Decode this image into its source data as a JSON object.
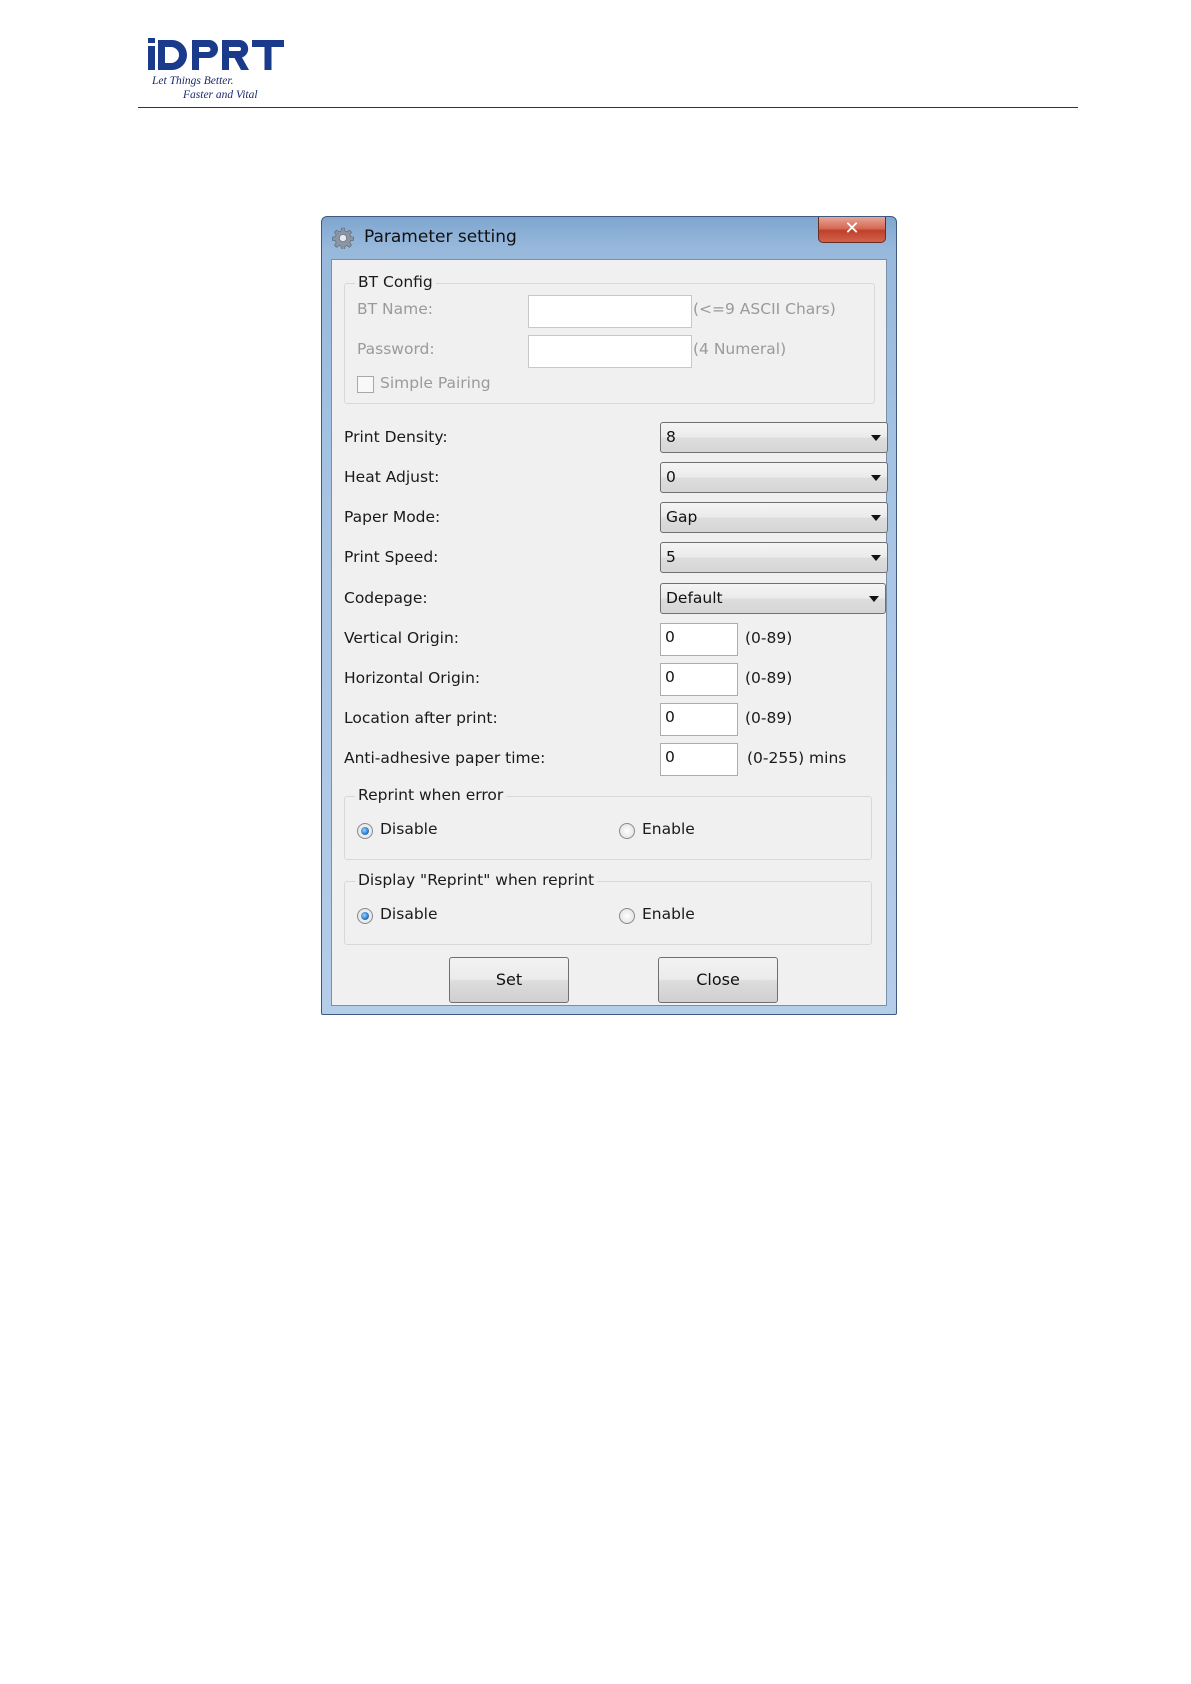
{
  "header": {
    "logo_text": "iDPRT",
    "tagline_1": "Let Things Better.",
    "tagline_2": "Faster and Vital"
  },
  "window": {
    "title": "Parameter setting",
    "close_glyph": "✕",
    "icon": "gear-icon"
  },
  "bt_config": {
    "title": "BT Config",
    "bt_name_label": "BT Name:",
    "bt_name_value": "",
    "bt_name_hint": "(<=9 ASCII Chars)",
    "password_label": "Password:",
    "password_value": "",
    "password_hint": "(4 Numeral)",
    "simple_pairing_label": "Simple Pairing",
    "simple_pairing_checked": false
  },
  "settings": {
    "print_density": {
      "label": "Print Density:",
      "value": "8"
    },
    "heat_adjust": {
      "label": "Heat Adjust:",
      "value": "0"
    },
    "paper_mode": {
      "label": "Paper Mode:",
      "value": "Gap"
    },
    "print_speed": {
      "label": "Print Speed:",
      "value": "5"
    },
    "codepage": {
      "label": "Codepage:",
      "value": "Default"
    },
    "vertical_origin": {
      "label": "Vertical Origin:",
      "value": "0",
      "hint": "(0-89)"
    },
    "horizontal_origin": {
      "label": "Horizontal Origin:",
      "value": "0",
      "hint": "(0-89)"
    },
    "location_after_print": {
      "label": "Location after print:",
      "value": "0",
      "hint": "(0-89)"
    },
    "anti_adhesive": {
      "label": "Anti-adhesive paper time:",
      "value": "0",
      "hint": "(0-255) mins"
    }
  },
  "reprint_when_error": {
    "title": "Reprint when error",
    "disable_label": "Disable",
    "enable_label": "Enable",
    "selected": "Disable"
  },
  "display_reprint": {
    "title": "Display \"Reprint\" when reprint",
    "disable_label": "Disable",
    "enable_label": "Enable",
    "selected": "Disable"
  },
  "buttons": {
    "set_label": "Set",
    "close_label": "Close"
  },
  "colors": {
    "brand": "#1a3a8c",
    "window_frame": "#a9c5e4",
    "client_bg": "#f0f0f0",
    "close_button": "#c7432c"
  }
}
